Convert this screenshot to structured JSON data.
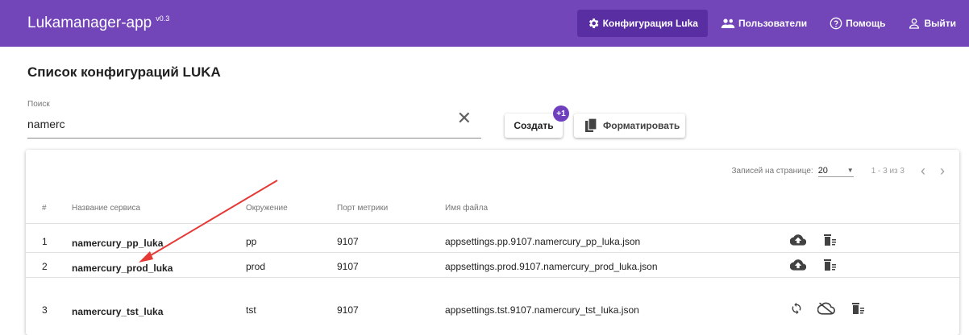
{
  "app": {
    "title": "Lukamanager-app",
    "version": "v0.3"
  },
  "nav": {
    "config": "Конфигурация Luka",
    "users": "Пользователи",
    "help": "Помощь",
    "logout": "Выйти"
  },
  "heading": "Список конфигураций LUKA",
  "search": {
    "label": "Поиск",
    "value": "namerc"
  },
  "actions": {
    "create": "Создать",
    "create_badge": "+1",
    "format": "Форматировать"
  },
  "pager": {
    "label": "Записей на странице:",
    "per_page": "20",
    "range": "1 - 3 из 3"
  },
  "table": {
    "headers": {
      "num": "#",
      "name": "Название сервиса",
      "env": "Окружение",
      "port": "Порт метрики",
      "file": "Имя файла"
    },
    "rows": [
      {
        "num": "1",
        "name": "namercury_pp_luka",
        "env": "pp",
        "port": "9107",
        "file": "appsettings.pp.9107.namercury_pp_luka.json"
      },
      {
        "num": "2",
        "name": "namercury_prod_luka",
        "env": "prod",
        "port": "9107",
        "file": "appsettings.prod.9107.namercury_prod_luka.json"
      },
      {
        "num": "3",
        "name": "namercury_tst_luka",
        "env": "tst",
        "port": "9107",
        "file": "appsettings.tst.9107.namercury_tst_luka.json"
      }
    ]
  },
  "colors": {
    "primary": "#7245b8",
    "active_nav": "#5a2ea3",
    "annotation_arrow": "#e53935"
  }
}
